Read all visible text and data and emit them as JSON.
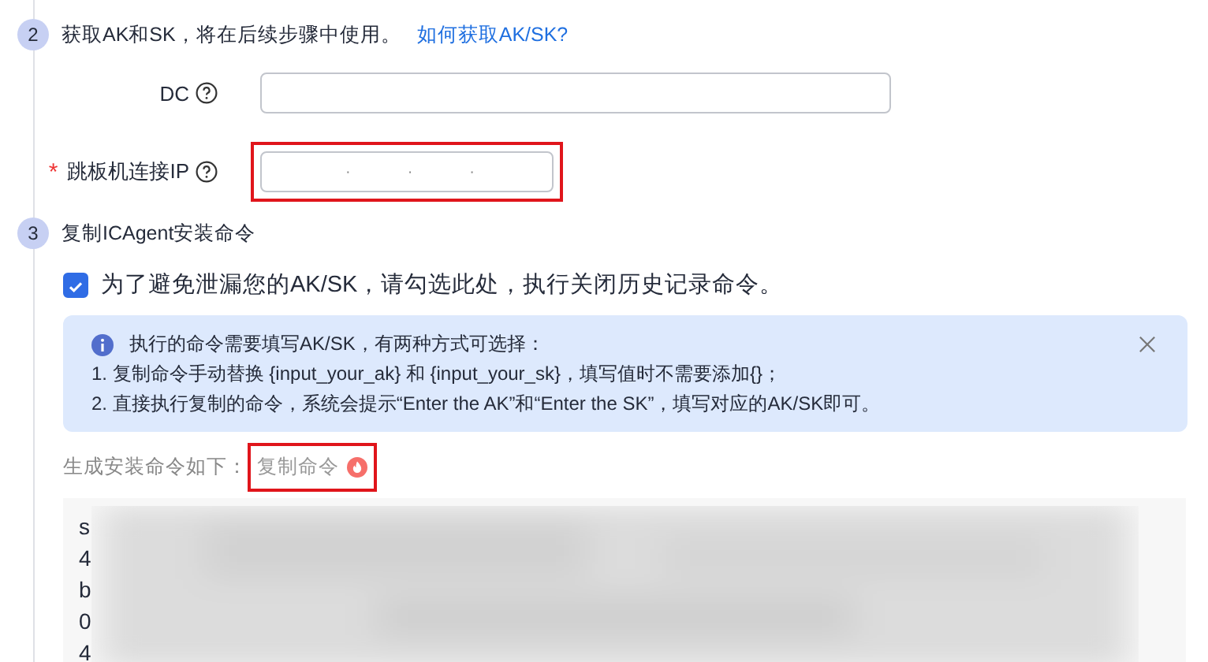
{
  "steps": [
    {
      "number": "2",
      "title": "获取AK和SK，将在后续步骤中使用。",
      "link": "如何获取AK/SK?"
    },
    {
      "number": "3",
      "title": "复制ICAgent安装命令"
    }
  ],
  "fields": [
    {
      "label": "DC",
      "required": false,
      "kind": "text",
      "highlighted": false
    },
    {
      "label": "跳板机连接IP",
      "required": true,
      "kind": "ip",
      "separators": [
        "·",
        "·",
        "·"
      ],
      "highlighted": true
    }
  ],
  "required_mark": "*",
  "checkbox": {
    "label": "为了避免泄漏您的AK/SK，请勾选此处，执行关闭历史记录命令。",
    "checked": true
  },
  "alert": {
    "title": "执行的命令需要填写AK/SK，有两种方式可选择：",
    "lines": [
      "1. 复制命令手动替换 {input_your_ak} 和 {input_your_sk}，填写值时不需要添加{}；",
      "2. 直接执行复制的命令，系统会提示“Enter the AK”和“Enter the SK”，填写对应的AK/SK即可。"
    ]
  },
  "command": {
    "label": "生成安装命令如下：",
    "copy_link": "复制命令",
    "copy_highlighted": true,
    "lines": [
      "s",
      "4",
      "b",
      "0",
      "4"
    ],
    "blurred": true
  }
}
